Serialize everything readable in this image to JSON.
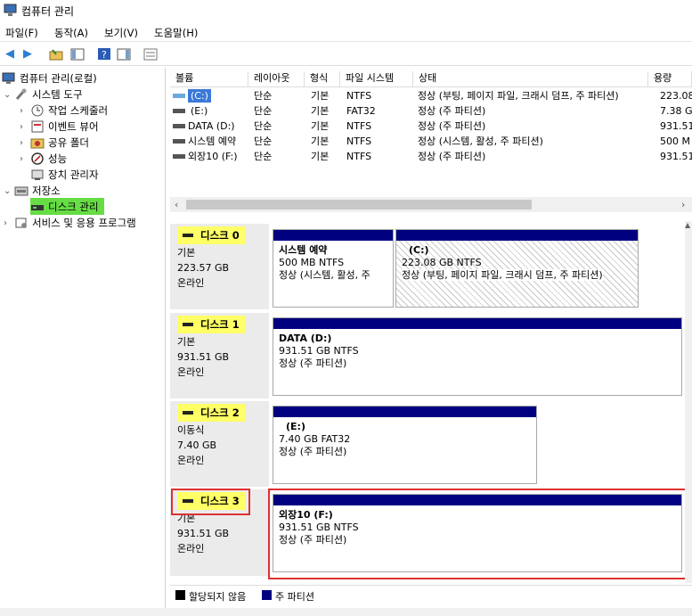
{
  "window": {
    "title": "컴퓨터 관리"
  },
  "menu": {
    "items": [
      "파일(F)",
      "동작(A)",
      "보기(V)",
      "도움말(H)"
    ]
  },
  "tree": {
    "root": "컴퓨터 관리(로컬)",
    "system_tools": "시스템 도구",
    "task_scheduler": "작업 스케줄러",
    "event_viewer": "이벤트 뷰어",
    "shared_folders": "공유 폴더",
    "performance": "성능",
    "device_manager": "장치 관리자",
    "storage": "저장소",
    "disk_management": "디스크 관리",
    "services": "서비스 및 응용 프로그램"
  },
  "volume_list": {
    "headers": [
      "볼륨",
      "레이아웃",
      "형식",
      "파일 시스템",
      "상태",
      "용량"
    ],
    "rows": [
      {
        "volume": "(C:)",
        "layout": "단순",
        "type": "기본",
        "fs": "NTFS",
        "status": "정상 (부팅, 페이지 파일, 크래시 덤프, 주 파티션)",
        "capacity": "223.08"
      },
      {
        "volume": "(E:)",
        "layout": "단순",
        "type": "기본",
        "fs": "FAT32",
        "status": "정상 (주 파티션)",
        "capacity": "7.38 G"
      },
      {
        "volume": "DATA (D:)",
        "layout": "단순",
        "type": "기본",
        "fs": "NTFS",
        "status": "정상 (주 파티션)",
        "capacity": "931.51"
      },
      {
        "volume": "시스템 예약",
        "layout": "단순",
        "type": "기본",
        "fs": "NTFS",
        "status": "정상 (시스템, 활성, 주 파티션)",
        "capacity": "500 M"
      },
      {
        "volume": "외장10 (F:)",
        "layout": "단순",
        "type": "기본",
        "fs": "NTFS",
        "status": "정상 (주 파티션)",
        "capacity": "931.51"
      }
    ]
  },
  "disks": [
    {
      "name": "디스크 0",
      "kind": "기본",
      "size": "223.57 GB",
      "state": "온라인",
      "partitions": [
        {
          "title": "시스템 예약",
          "size_fs": "500 MB NTFS",
          "status": "정상 (시스템, 활성, 주"
        },
        {
          "title": "(C:)",
          "size_fs": "223.08 GB NTFS",
          "status": "정상 (부팅, 페이지 파일, 크래시 덤프, 주 파티션)"
        }
      ]
    },
    {
      "name": "디스크 1",
      "kind": "기본",
      "size": "931.51 GB",
      "state": "온라인",
      "partitions": [
        {
          "title": "DATA  (D:)",
          "size_fs": "931.51 GB NTFS",
          "status": "정상 (주 파티션)"
        }
      ]
    },
    {
      "name": "디스크 2",
      "kind": "이동식",
      "size": "7.40 GB",
      "state": "온라인",
      "partitions": [
        {
          "title": "(E:)",
          "size_fs": "7.40 GB FAT32",
          "status": "정상 (주 파티션)"
        }
      ]
    },
    {
      "name": "디스크 3",
      "kind": "기본",
      "size": "931.51 GB",
      "state": "온라인",
      "partitions": [
        {
          "title": "외장10  (F:)",
          "size_fs": "931.51 GB NTFS",
          "status": "정상 (주 파티션)"
        }
      ]
    }
  ],
  "legend": {
    "unallocated": "할당되지 않음",
    "primary": "주 파티션"
  },
  "colors": {
    "primary_partition": "#000080",
    "highlight": "#ffff66",
    "selected_node": "#66dd44",
    "callout": "#e03030"
  }
}
